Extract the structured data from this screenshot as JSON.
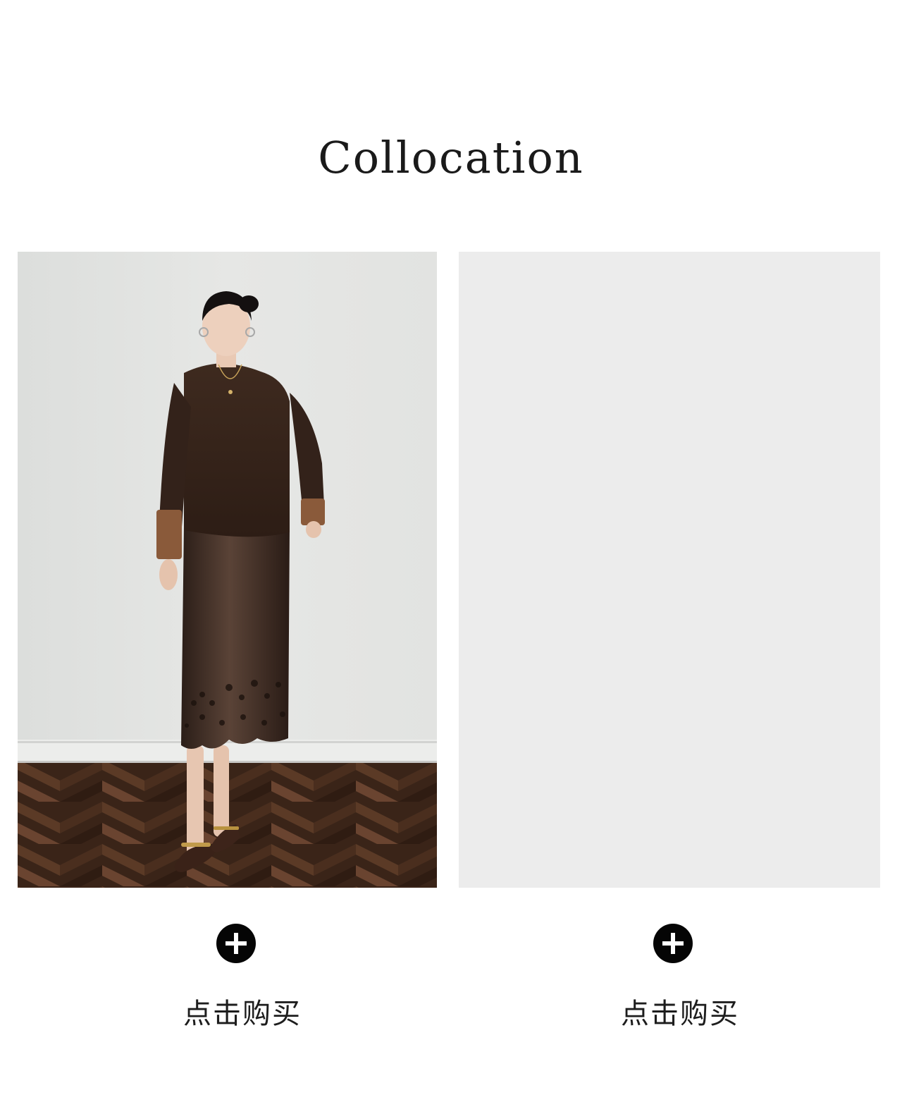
{
  "page": {
    "title": "Collocation"
  },
  "products": [
    {
      "image": "model-outfit-photo",
      "buy_label": "点击购买",
      "add_icon": "plus-circle-icon"
    },
    {
      "image": "empty-product-placeholder",
      "buy_label": "点击购买",
      "add_icon": "plus-circle-icon"
    }
  ],
  "colors": {
    "background": "#ffffff",
    "title_text": "#1a1a1a",
    "icon_fill": "#050505",
    "placeholder": "#ececec"
  }
}
